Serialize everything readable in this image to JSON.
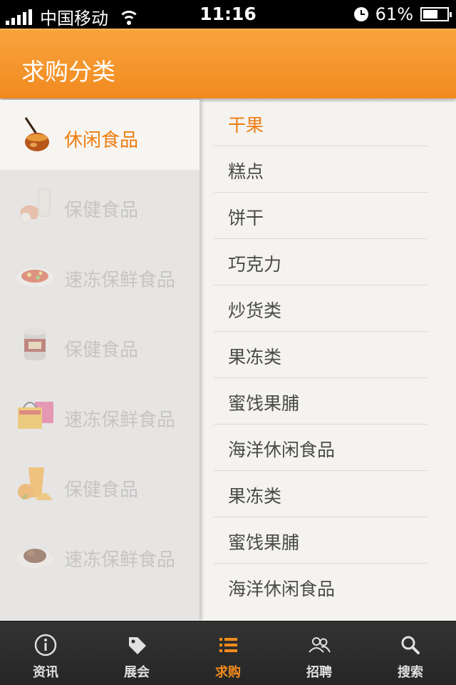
{
  "status_bar": {
    "carrier": "中国移动",
    "time": "11:16",
    "battery": "61%",
    "battery_level": 0.61,
    "icons": [
      "signal-icon",
      "wifi-icon",
      "clock-icon",
      "battery-icon"
    ]
  },
  "header": {
    "title": "求购分类"
  },
  "accent_color": "#ef7d12",
  "categories": [
    {
      "label": "休闲食品",
      "icon": "honey-jar-icon",
      "active": true
    },
    {
      "label": "保健食品",
      "icon": "dairy-products-icon",
      "active": false
    },
    {
      "label": "速冻保鲜食品",
      "icon": "stir-fry-plate-icon",
      "active": false
    },
    {
      "label": "保健食品",
      "icon": "canned-food-icon",
      "active": false
    },
    {
      "label": "速冻保鲜食品",
      "icon": "gift-box-icon",
      "active": false
    },
    {
      "label": "保健食品",
      "icon": "orange-juice-icon",
      "active": false
    },
    {
      "label": "速冻保鲜食品",
      "icon": "braised-meat-icon",
      "active": false
    }
  ],
  "subcategories": [
    {
      "label": "干果",
      "active": true
    },
    {
      "label": "糕点",
      "active": false
    },
    {
      "label": "饼干",
      "active": false
    },
    {
      "label": "巧克力",
      "active": false
    },
    {
      "label": "炒货类",
      "active": false
    },
    {
      "label": "果冻类",
      "active": false
    },
    {
      "label": "蜜饯果脯",
      "active": false
    },
    {
      "label": "海洋休闲食品",
      "active": false
    },
    {
      "label": "果冻类",
      "active": false
    },
    {
      "label": "蜜饯果脯",
      "active": false
    },
    {
      "label": "海洋休闲食品",
      "active": false
    }
  ],
  "tabs": [
    {
      "label": "资讯",
      "icon": "info-icon",
      "active": false
    },
    {
      "label": "展会",
      "icon": "tag-icon",
      "active": false
    },
    {
      "label": "求购",
      "icon": "list-icon",
      "active": true
    },
    {
      "label": "招聘",
      "icon": "people-icon",
      "active": false
    },
    {
      "label": "搜索",
      "icon": "search-icon",
      "active": false
    }
  ]
}
